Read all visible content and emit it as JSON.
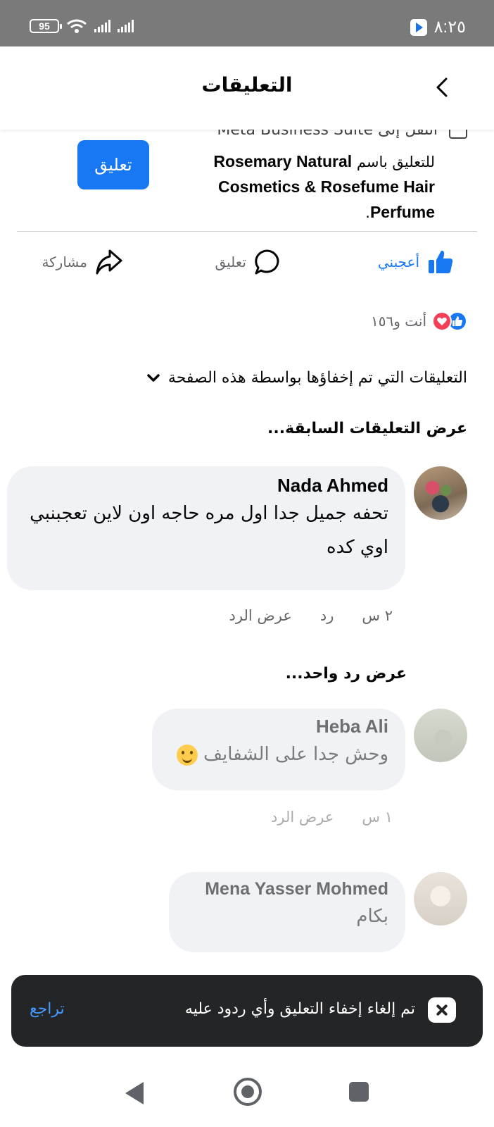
{
  "status_bar": {
    "battery": "95",
    "time": "٨:٢٥"
  },
  "header": {
    "title": "التعليقات"
  },
  "post": {
    "partial_line": "انتقل إلى Meta Business Suite",
    "comment_as_prefix": "للتعليق باسم",
    "page_name": "Rosemary Natural Cosmetics & Rosefume Hair Perfume",
    "comment_as_suffix": ".",
    "comment_button": "تعليق"
  },
  "actions": {
    "like": "أعجبني",
    "comment": "تعليق",
    "share": "مشاركة"
  },
  "reactions": {
    "summary": "أنت و١٥٦"
  },
  "hidden_comments": {
    "label": "التعليقات التي تم إخفاؤها بواسطة هذه الصفحة"
  },
  "view_previous": "عرض التعليقات السابقة...",
  "comments": [
    {
      "author": "Nada Ahmed",
      "text": "تحفه جميل جدا اول مره حاجه اون لاين تعجبنبي اوي كده",
      "time": "٢ س",
      "reply": "رد",
      "view_reply": "عرض الرد"
    }
  ],
  "view_one_reply": "عرض رد واحد...",
  "hidden": [
    {
      "author": "Heba Ali",
      "text": "وحش جدا على الشفايف",
      "time": "١ س",
      "view_reply": "عرض الرد"
    },
    {
      "author": "Mena Yasser Mohmed",
      "text": "بكام"
    }
  ],
  "snackbar": {
    "message": "تم إلغاء إخفاء التعليق وأي ردود عليه",
    "undo": "تراجع"
  },
  "colors": {
    "accent": "#1877f2",
    "bubble": "#f0f2f5",
    "snackbar": "#242526"
  }
}
